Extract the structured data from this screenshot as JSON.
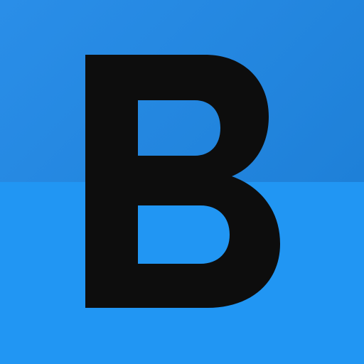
{
  "icon": {
    "name": "letter-b-icon",
    "letter": "B",
    "colors": {
      "top_from": "#2a8ee8",
      "top_to": "#1e80d8",
      "bottom": "#2196f3",
      "glyph": "#0d0d0d"
    }
  }
}
